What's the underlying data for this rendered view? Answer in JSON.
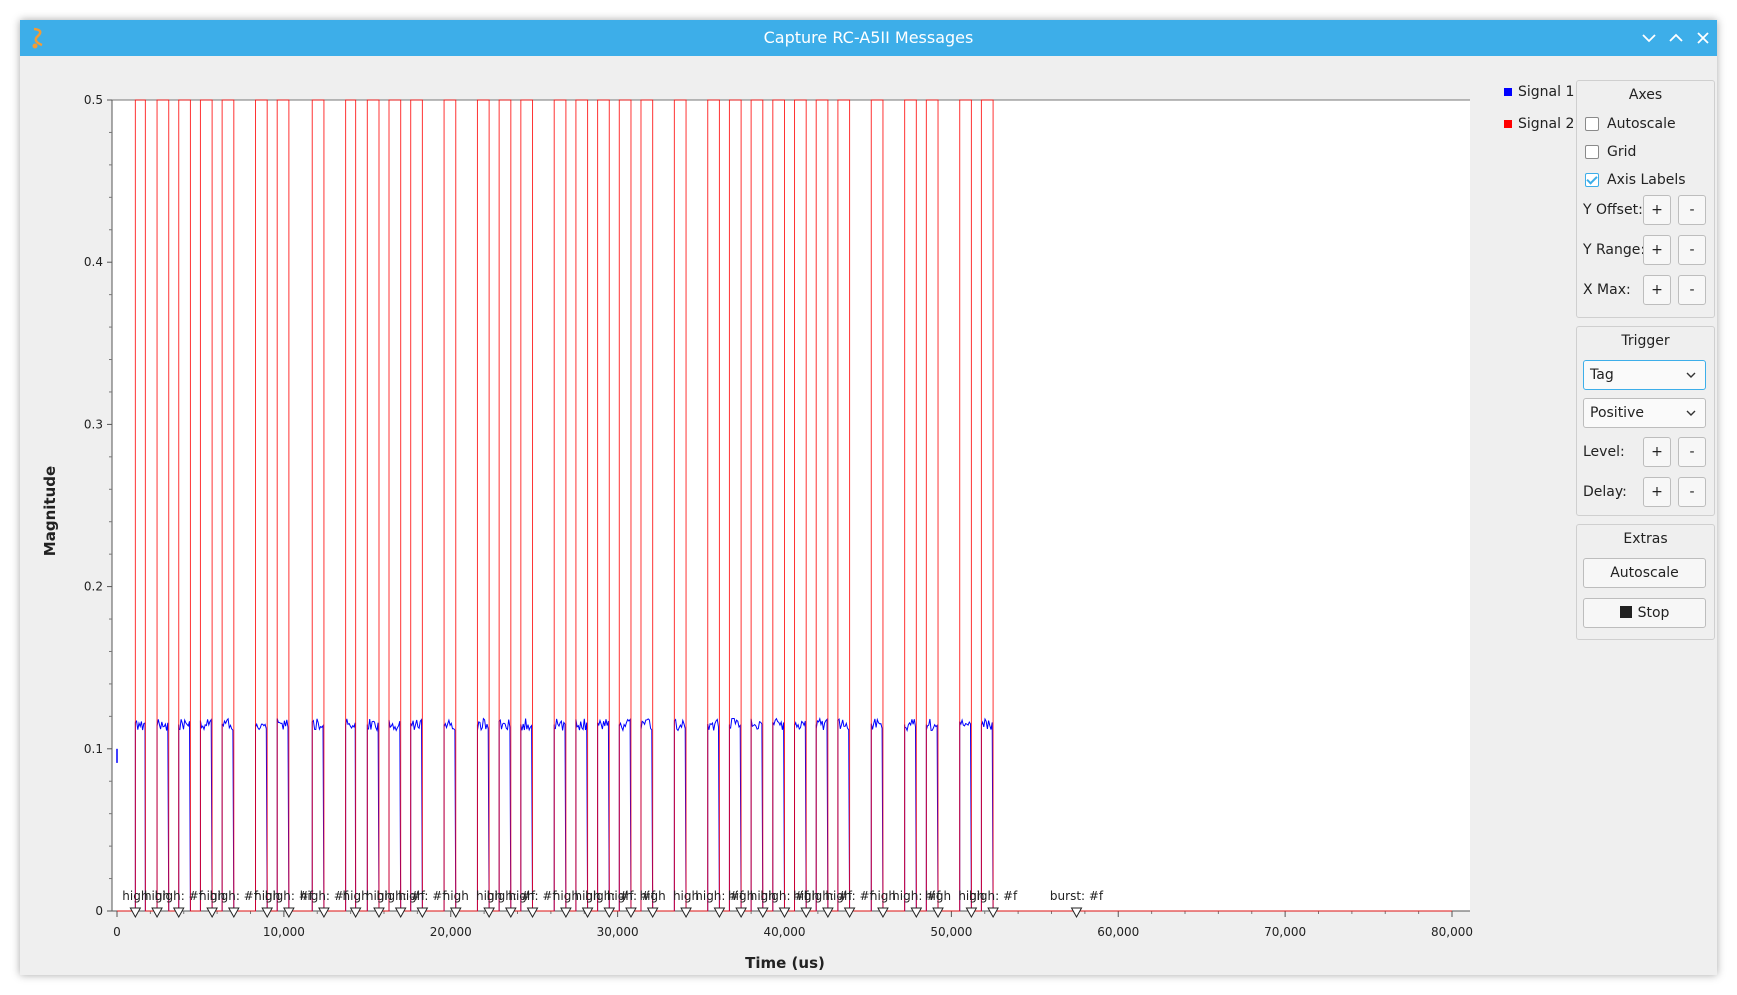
{
  "window": {
    "title": "Capture RC-A5II Messages"
  },
  "chart_data": {
    "type": "line",
    "ylabel": "Magnitude",
    "xlabel": "Time (us)",
    "xlim": [
      0,
      80000
    ],
    "ylim": [
      0,
      0.5
    ],
    "y_ticks": [
      "0",
      "0.1",
      "0.2",
      "0.3",
      "0.4",
      "0.5"
    ],
    "x_ticks": [
      "0",
      "10,000",
      "20,000",
      "30,000",
      "40,000",
      "50,000",
      "60,000",
      "70,000",
      "80,000"
    ],
    "grid": false,
    "legend_position": "right",
    "series": [
      {
        "name": "Signal 1",
        "color": "#0000ff",
        "description_level": 0.115
      },
      {
        "name": "Signal 2",
        "color": "#ff0000",
        "high_level": 0.5,
        "low_level": 0
      }
    ],
    "pulse_edges": [
      [
        1100,
        1700
      ],
      [
        2400,
        3100
      ],
      [
        3700,
        4400
      ],
      [
        5000,
        5700
      ],
      [
        6300,
        7000
      ],
      [
        8300,
        9000
      ],
      [
        9600,
        10300
      ],
      [
        11700,
        12400
      ],
      [
        13700,
        14300
      ],
      [
        15000,
        15700
      ],
      [
        16300,
        17000
      ],
      [
        17600,
        18300
      ],
      [
        19600,
        20300
      ],
      [
        21600,
        22300
      ],
      [
        22900,
        23600
      ],
      [
        24200,
        24900
      ],
      [
        26200,
        26900
      ],
      [
        27500,
        28200
      ],
      [
        28800,
        29500
      ],
      [
        30100,
        30800
      ],
      [
        31400,
        32100
      ],
      [
        33400,
        34100
      ],
      [
        35400,
        36100
      ],
      [
        36700,
        37400
      ],
      [
        38000,
        38700
      ],
      [
        39300,
        40000
      ],
      [
        40600,
        41300
      ],
      [
        41900,
        42600
      ],
      [
        43200,
        43900
      ],
      [
        45200,
        45900
      ],
      [
        47200,
        47900
      ],
      [
        48500,
        49200
      ],
      [
        50500,
        51200
      ],
      [
        51800,
        52500
      ]
    ],
    "tags": [
      {
        "x": 1100,
        "label": "high"
      },
      {
        "x": 2400,
        "label": "high"
      },
      {
        "x": 3700,
        "label": "high: #f"
      },
      {
        "x": 5700,
        "label": "high"
      },
      {
        "x": 7000,
        "label": "high: #f"
      },
      {
        "x": 9000,
        "label": "high"
      },
      {
        "x": 10300,
        "label": "high: #f"
      },
      {
        "x": 12400,
        "label": "high: #f"
      },
      {
        "x": 14300,
        "label": "high"
      },
      {
        "x": 15700,
        "label": "high"
      },
      {
        "x": 17000,
        "label": "high: #f"
      },
      {
        "x": 18300,
        "label": "high: #f"
      },
      {
        "x": 20300,
        "label": "high"
      },
      {
        "x": 22300,
        "label": "high"
      },
      {
        "x": 23600,
        "label": "high: #f"
      },
      {
        "x": 24900,
        "label": "high: #f"
      },
      {
        "x": 26900,
        "label": "high"
      },
      {
        "x": 28200,
        "label": "high"
      },
      {
        "x": 29500,
        "label": "high: #f"
      },
      {
        "x": 30800,
        "label": "high: #f"
      },
      {
        "x": 32100,
        "label": "high"
      },
      {
        "x": 34100,
        "label": "high"
      },
      {
        "x": 36100,
        "label": "high: #f"
      },
      {
        "x": 37400,
        "label": "high"
      },
      {
        "x": 38700,
        "label": "high"
      },
      {
        "x": 40000,
        "label": "high: #f"
      },
      {
        "x": 41300,
        "label": "high"
      },
      {
        "x": 42600,
        "label": "high: #f"
      },
      {
        "x": 43900,
        "label": "high: #f"
      },
      {
        "x": 45900,
        "label": "high"
      },
      {
        "x": 47900,
        "label": "high: #f"
      },
      {
        "x": 49200,
        "label": "high"
      },
      {
        "x": 51200,
        "label": "high"
      },
      {
        "x": 52500,
        "label": "high: #f"
      },
      {
        "x": 57500,
        "label": "burst: #f"
      }
    ]
  },
  "legend": [
    {
      "label": "Signal 1",
      "color": "#0000ff"
    },
    {
      "label": "Signal 2",
      "color": "#ff0000"
    }
  ],
  "axes_panel": {
    "title": "Axes",
    "autoscale": {
      "label": "Autoscale",
      "checked": false
    },
    "grid": {
      "label": "Grid",
      "checked": false
    },
    "axis_labels": {
      "label": "Axis Labels",
      "checked": true
    },
    "y_offset": "Y Offset:",
    "y_range": "Y Range:",
    "x_max": "X Max:",
    "plus": "+",
    "minus": "-"
  },
  "trigger_panel": {
    "title": "Trigger",
    "mode": "Tag",
    "slope": "Positive",
    "level": "Level:",
    "delay": "Delay:"
  },
  "extras_panel": {
    "title": "Extras",
    "autoscale": "Autoscale",
    "stop": "Stop"
  },
  "colors": {
    "titlebar": "#3daee9",
    "accent": "#3daee9"
  }
}
